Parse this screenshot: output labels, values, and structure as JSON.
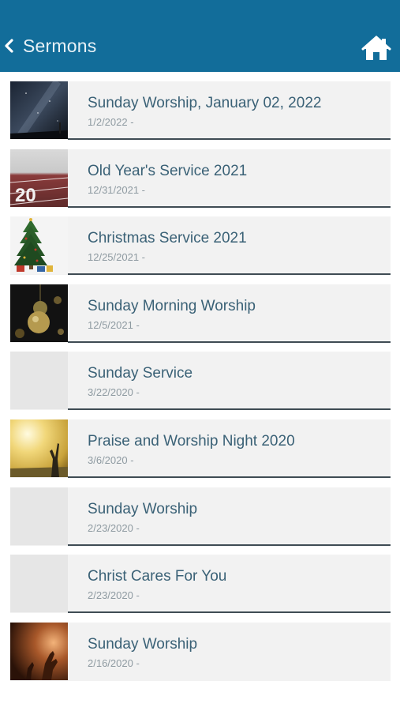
{
  "header": {
    "title": "Sermons",
    "back_icon": "chevron-left-icon",
    "home_icon": "home-icon",
    "bg_color": "#126d9a"
  },
  "sermons": [
    {
      "title": "Sunday Worship, January 02, 2022",
      "subtitle": "1/2/2022 -",
      "thumbnail": "night-sky"
    },
    {
      "title": "Old Year's Service 2021",
      "subtitle": "12/31/2021 -",
      "thumbnail": "track-2021"
    },
    {
      "title": "Christmas Service 2021",
      "subtitle": "12/25/2021 -",
      "thumbnail": "christmas-tree"
    },
    {
      "title": "Sunday Morning Worship",
      "subtitle": "12/5/2021 -",
      "thumbnail": "ornaments"
    },
    {
      "title": "Sunday Service",
      "subtitle": "3/22/2020 -",
      "thumbnail": "none"
    },
    {
      "title": "Praise and Worship Night 2020",
      "subtitle": "3/6/2020 -",
      "thumbnail": "sunlight-praise"
    },
    {
      "title": "Sunday Worship",
      "subtitle": "2/23/2020 -",
      "thumbnail": "none"
    },
    {
      "title": "Christ Cares For You",
      "subtitle": "2/23/2020 -",
      "thumbnail": "none"
    },
    {
      "title": "Sunday Worship",
      "subtitle": "2/16/2020 -",
      "thumbnail": "praying-hands"
    }
  ]
}
